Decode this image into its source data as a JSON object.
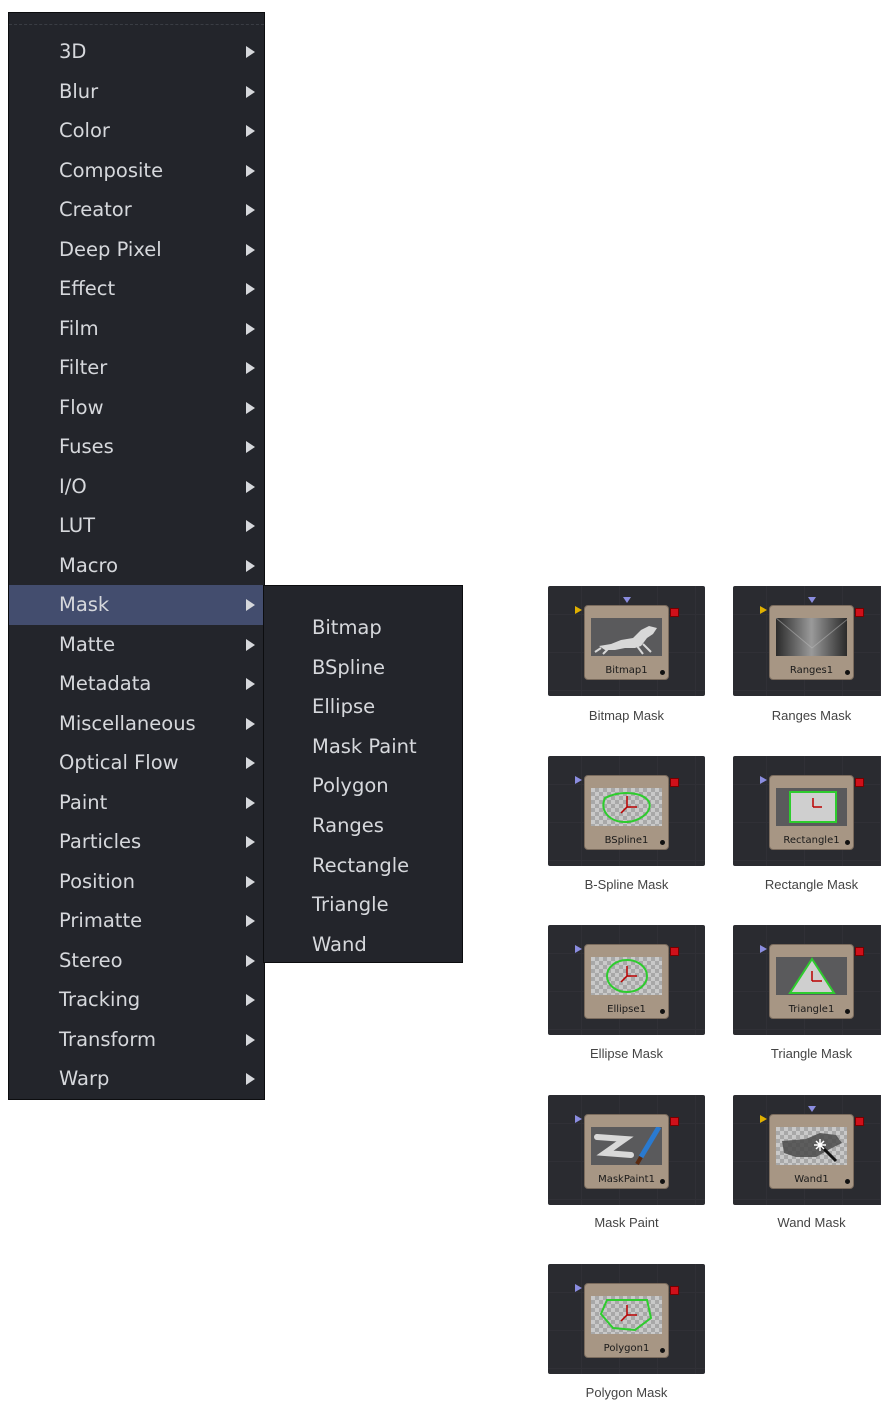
{
  "main_menu": {
    "items": [
      {
        "label": "3D"
      },
      {
        "label": "Blur"
      },
      {
        "label": "Color"
      },
      {
        "label": "Composite"
      },
      {
        "label": "Creator"
      },
      {
        "label": "Deep Pixel"
      },
      {
        "label": "Effect"
      },
      {
        "label": "Film"
      },
      {
        "label": "Filter"
      },
      {
        "label": "Flow"
      },
      {
        "label": "Fuses"
      },
      {
        "label": "I/O"
      },
      {
        "label": "LUT"
      },
      {
        "label": "Macro"
      },
      {
        "label": "Mask",
        "active": true
      },
      {
        "label": "Matte"
      },
      {
        "label": "Metadata"
      },
      {
        "label": "Miscellaneous"
      },
      {
        "label": "Optical Flow"
      },
      {
        "label": "Paint"
      },
      {
        "label": "Particles"
      },
      {
        "label": "Position"
      },
      {
        "label": "Primatte"
      },
      {
        "label": "Stereo"
      },
      {
        "label": "Tracking"
      },
      {
        "label": "Transform"
      },
      {
        "label": "Warp"
      }
    ]
  },
  "submenu": {
    "items": [
      "Bitmap",
      "BSpline",
      "Ellipse",
      "Mask Paint",
      "Polygon",
      "Ranges",
      "Rectangle",
      "Triangle",
      "Wand"
    ]
  },
  "nodes": [
    {
      "node_label": "Bitmap1",
      "caption": "Bitmap Mask"
    },
    {
      "node_label": "Ranges1",
      "caption": "Ranges Mask"
    },
    {
      "node_label": "BSpline1",
      "caption": "B-Spline Mask"
    },
    {
      "node_label": "Rectangle1",
      "caption": "Rectangle Mask"
    },
    {
      "node_label": "Ellipse1",
      "caption": "Ellipse Mask"
    },
    {
      "node_label": "Triangle1",
      "caption": "Triangle Mask"
    },
    {
      "node_label": "MaskPaint1",
      "caption": "Mask Paint"
    },
    {
      "node_label": "Wand1",
      "caption": "Wand Mask"
    },
    {
      "node_label": "Polygon1",
      "caption": "Polygon Mask"
    }
  ],
  "colors": {
    "menu_bg": "#23252b",
    "menu_highlight": "#434d6e",
    "node_body": "#a79684",
    "output_red": "#d0101a",
    "shape_green": "#2ecc2e"
  }
}
